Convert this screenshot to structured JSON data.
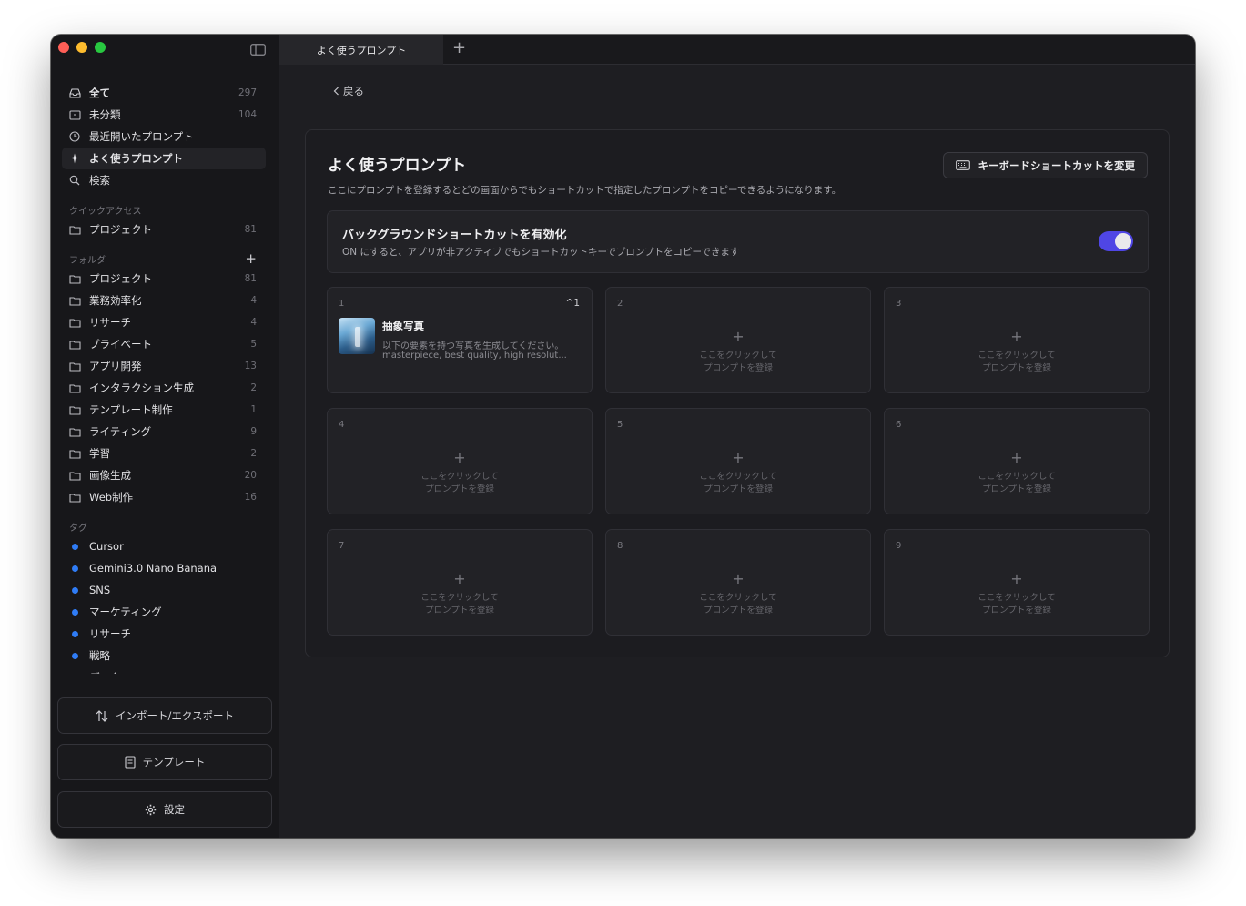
{
  "window": {
    "tab_title": "よく使うプロンプト"
  },
  "sidebar": {
    "nav": [
      {
        "label": "全て",
        "count": "297",
        "icon": "inbox-icon"
      },
      {
        "label": "未分類",
        "count": "104",
        "icon": "box-icon"
      },
      {
        "label": "最近開いたプロンプト",
        "count": "",
        "icon": "clock-icon"
      },
      {
        "label": "よく使うプロンプト",
        "count": "",
        "icon": "sparkle-icon"
      },
      {
        "label": "検索",
        "count": "",
        "icon": "search-icon"
      }
    ],
    "quick_access": {
      "title": "クイックアクセス",
      "items": [
        {
          "label": "プロジェクト",
          "count": "81"
        }
      ]
    },
    "folders": {
      "title": "フォルダ",
      "items": [
        {
          "label": "プロジェクト",
          "count": "81"
        },
        {
          "label": "業務効率化",
          "count": "4"
        },
        {
          "label": "リサーチ",
          "count": "4"
        },
        {
          "label": "プライベート",
          "count": "5"
        },
        {
          "label": "アプリ開発",
          "count": "13"
        },
        {
          "label": "インタラクション生成",
          "count": "2"
        },
        {
          "label": "テンプレート制作",
          "count": "1"
        },
        {
          "label": "ライティング",
          "count": "9"
        },
        {
          "label": "学習",
          "count": "2"
        },
        {
          "label": "画像生成",
          "count": "20"
        },
        {
          "label": "Web制作",
          "count": "16"
        }
      ]
    },
    "tags": {
      "title": "タグ",
      "items": [
        "Cursor",
        "Gemini3.0 Nano Banana",
        "SNS",
        "マーケティング",
        "リサーチ",
        "戦略",
        "データ"
      ],
      "color": "#2f7cf6"
    },
    "buttons": {
      "import_export": "インポート/エクスポート",
      "template": "テンプレート",
      "settings": "設定"
    }
  },
  "main": {
    "back_label": "戻る",
    "panel": {
      "title": "よく使うプロンプト",
      "description": "ここにプロンプトを登録するとどの画面からでもショートカットで指定したプロンプトをコピーできるようになります。",
      "shortcut_button": "キーボードショートカットを変更",
      "background_toggle": {
        "title": "バックグラウンドショートカットを有効化",
        "description": "ON にすると、アプリが非アクティブでもショートカットキーでプロンプトをコピーできます",
        "enabled": true,
        "accent": "#4f46e5"
      },
      "slots": [
        {
          "num": "1",
          "filled": true,
          "key": "^1",
          "title": "抽象写真",
          "line1": "以下の要素を持つ写真を生成してください。",
          "line2": "masterpiece, best quality, high resolut..."
        },
        {
          "num": "2",
          "filled": false
        },
        {
          "num": "3",
          "filled": false
        },
        {
          "num": "4",
          "filled": false
        },
        {
          "num": "5",
          "filled": false
        },
        {
          "num": "6",
          "filled": false
        },
        {
          "num": "7",
          "filled": false
        },
        {
          "num": "8",
          "filled": false
        },
        {
          "num": "9",
          "filled": false
        }
      ],
      "empty_line1": "ここをクリックして",
      "empty_line2": "プロンプトを登録"
    }
  }
}
